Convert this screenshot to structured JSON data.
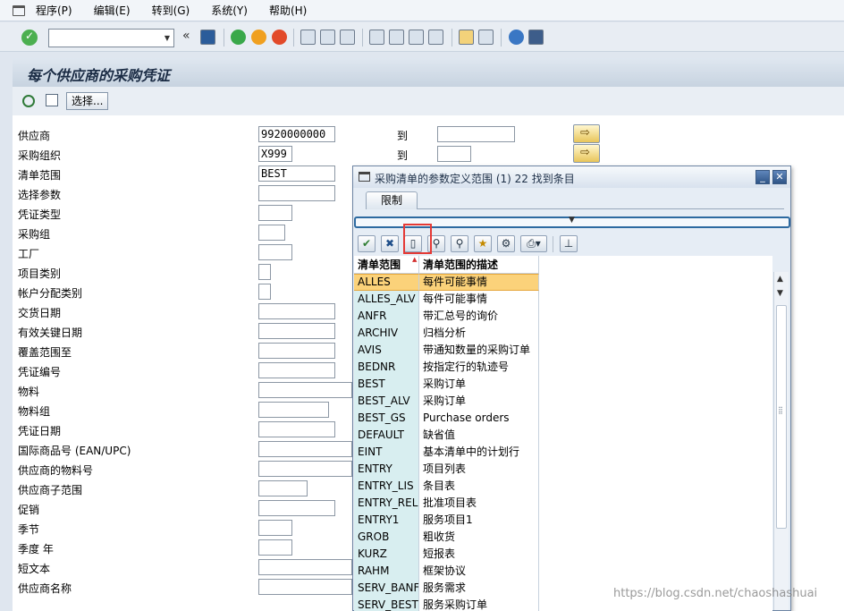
{
  "menu": {
    "items": [
      "程序(P)",
      "编辑(E)",
      "转到(G)",
      "系统(Y)",
      "帮助(H)"
    ]
  },
  "toolbar": {
    "command_value": "",
    "back_label": "«"
  },
  "screen": {
    "title": "每个供应商的采购凭证",
    "selection_button": "选择..."
  },
  "form": {
    "to_label": "到",
    "fields": [
      {
        "label": "供应商",
        "value": "9920000000"
      },
      {
        "label": "采购组织",
        "value": "X999"
      },
      {
        "label": "清单范围",
        "value": "BEST"
      },
      {
        "label": "选择参数",
        "value": ""
      },
      {
        "label": "凭证类型",
        "value": ""
      },
      {
        "label": "采购组",
        "value": ""
      },
      {
        "label": "工厂",
        "value": ""
      },
      {
        "label": "项目类别",
        "value": ""
      },
      {
        "label": "帐户分配类别",
        "value": ""
      },
      {
        "label": "交货日期",
        "value": ""
      },
      {
        "label": "有效关键日期",
        "value": ""
      },
      {
        "label": "覆盖范围至",
        "value": ""
      },
      {
        "label": "凭证编号",
        "value": ""
      },
      {
        "label": "物料",
        "value": ""
      },
      {
        "label": "物料组",
        "value": ""
      },
      {
        "label": "凭证日期",
        "value": ""
      },
      {
        "label": "国际商品号 (EAN/UPC)",
        "value": ""
      },
      {
        "label": "供应商的物料号",
        "value": ""
      },
      {
        "label": "供应商子范围",
        "value": ""
      },
      {
        "label": "促销",
        "value": ""
      },
      {
        "label": "季节",
        "value": ""
      },
      {
        "label": "季度 年",
        "value": ""
      },
      {
        "label": "短文本",
        "value": ""
      },
      {
        "label": "供应商名称",
        "value": ""
      }
    ]
  },
  "dialog": {
    "title": "采购清单的参数定义范围 (1)   22 找到条目",
    "tab_label": "限制",
    "columns": [
      "清单范围",
      "清单范围的描述"
    ],
    "rows": [
      {
        "key": "ALLES",
        "desc": "每件可能事情"
      },
      {
        "key": "ALLES_ALV",
        "desc": "每件可能事情"
      },
      {
        "key": "ANFR",
        "desc": "带汇总号的询价"
      },
      {
        "key": "ARCHIV",
        "desc": "归档分析"
      },
      {
        "key": "AVIS",
        "desc": "带通知数量的采购订单"
      },
      {
        "key": "BEDNR",
        "desc": "按指定行的轨迹号"
      },
      {
        "key": "BEST",
        "desc": "采购订单"
      },
      {
        "key": "BEST_ALV",
        "desc": "采购订单"
      },
      {
        "key": "BEST_GS",
        "desc": "Purchase orders"
      },
      {
        "key": "DEFAULT",
        "desc": "缺省值"
      },
      {
        "key": "EINT",
        "desc": "基本清单中的计划行"
      },
      {
        "key": "ENTRY",
        "desc": "项目列表"
      },
      {
        "key": "ENTRY_LIS",
        "desc": "条目表"
      },
      {
        "key": "ENTRY_REL",
        "desc": "批准项目表"
      },
      {
        "key": "ENTRY1",
        "desc": "服务项目1"
      },
      {
        "key": "GROB",
        "desc": "粗收货"
      },
      {
        "key": "KURZ",
        "desc": "短报表"
      },
      {
        "key": "RAHM",
        "desc": "框架协议"
      },
      {
        "key": "SERV_BANF",
        "desc": "服务需求"
      },
      {
        "key": "SERV_BEST",
        "desc": "服务采购订单"
      }
    ]
  },
  "watermark": "https://blog.csdn.net/chaoshashuai",
  "colors": {
    "selected_row": "#fbd27a",
    "key_column": "#d8eef0",
    "highlight_box": "#e53935"
  }
}
